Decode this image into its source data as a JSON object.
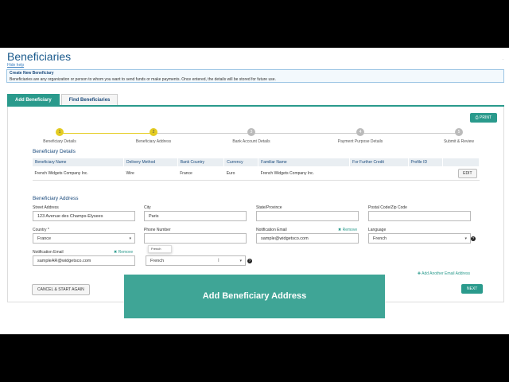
{
  "page": {
    "title": "Beneficiaries",
    "hide_help": "Hide help",
    "top_right_text": "..."
  },
  "info": {
    "title": "Create New Beneficiary",
    "text": "Beneficiaries are any organization or person to whom you want to send funds or make payments. Once entered, the details will be stored for future use."
  },
  "tabs": [
    {
      "label": "Add Beneficiary",
      "active": true
    },
    {
      "label": "Find Beneficiaries",
      "active": false
    }
  ],
  "print_label": "PRINT",
  "steps": [
    {
      "num": "1",
      "label": "Beneficiary Details",
      "done": true
    },
    {
      "num": "2",
      "label": "Beneficiary Address",
      "done": true
    },
    {
      "num": "3",
      "label": "Bank Account Details",
      "done": false
    },
    {
      "num": "4",
      "label": "Payment Purpose Details",
      "done": false
    },
    {
      "num": "5",
      "label": "Submit & Review",
      "done": false
    }
  ],
  "details": {
    "title": "Beneficiary Details",
    "columns": [
      "Beneficiary Name",
      "Delivery Method",
      "Bank Country",
      "Currency",
      "Familiar Name",
      "For Further Credit",
      "Profile ID",
      ""
    ],
    "row": [
      "French Widgets Company Inc.",
      "Wire",
      "France",
      "Euro",
      "French Widgets Company Inc.",
      "",
      ""
    ],
    "edit_label": "EDIT"
  },
  "address": {
    "title": "Beneficiary Address",
    "street_label": "Street Address",
    "street_value": "123 Avenue des Champs-Elysees",
    "city_label": "City",
    "city_value": "Paris",
    "state_label": "State/Province",
    "state_value": "",
    "zip_label": "Postal Code/Zip Code",
    "zip_value": "",
    "country_label": "Country *",
    "country_value": "France",
    "phone_label": "Phone Number",
    "phone_value": "",
    "notif1_label": "Notification Email",
    "notif1_value": "sample@widgetsco.com",
    "remove_label": "✖ Remove",
    "language_label": "Language",
    "language_value": "French",
    "notif2_label": "Notification Email",
    "notif2_value": "sampleAR@widgetsco.com",
    "remove2_label": "✖ Remove",
    "language2_value": "French",
    "tooltip_text": "French",
    "add_email_label": "✚ Add Another Email Address"
  },
  "buttons": {
    "cancel": "CANCEL & START AGAIN",
    "next": "NEXT"
  },
  "overlay": {
    "text": "Add Beneficiary Address"
  },
  "colors": {
    "accent": "#2a9a8c",
    "step_done": "#e4cc22",
    "title_blue": "#1a5a8c",
    "overlay": "#3fa596"
  }
}
